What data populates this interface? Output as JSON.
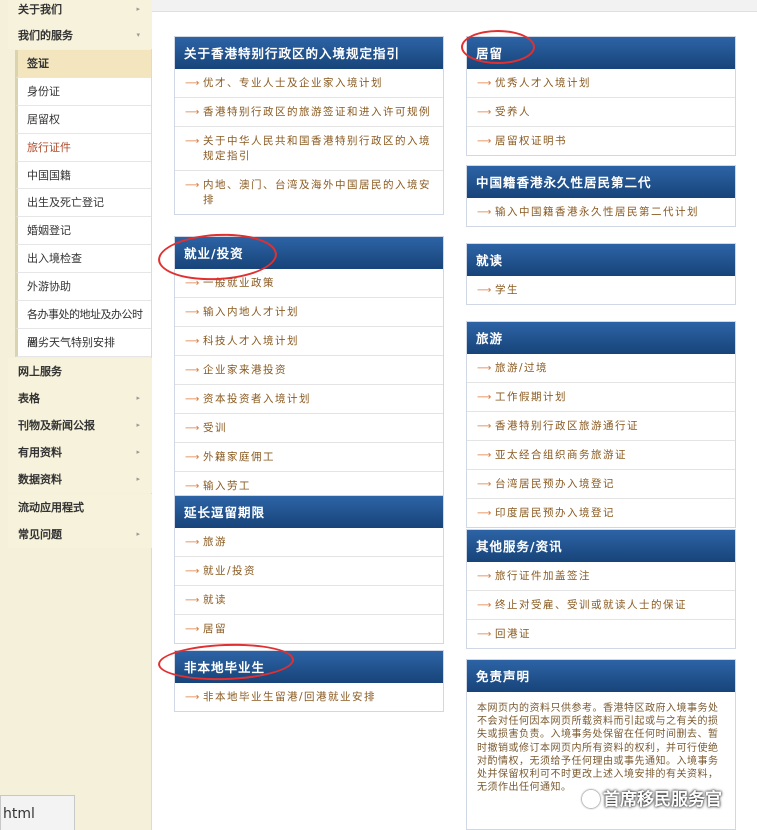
{
  "sidebar": {
    "nav_top": [
      {
        "label": "关于我们",
        "arrow": "▸"
      },
      {
        "label": "我们的服务",
        "arrow": "▾"
      }
    ],
    "sub": [
      "签证",
      "身份证",
      "居留权",
      "旅行证件",
      "中国国籍",
      "出生及死亡登记",
      "婚姻登记",
      "出入境检查",
      "外游协助",
      "各办事处的地址及办公时间",
      "恶劣天气特别安排"
    ],
    "nav_bottom": [
      {
        "label": "网上服务",
        "arrow": ""
      },
      {
        "label": "表格",
        "arrow": "▸"
      },
      {
        "label": "刊物及新闻公报",
        "arrow": "▸"
      },
      {
        "label": "有用资料",
        "arrow": "▸"
      },
      {
        "label": "数据资料",
        "arrow": "▸"
      },
      {
        "label": "流动应用程式",
        "arrow": ""
      },
      {
        "label": "常见问题",
        "arrow": "▸"
      }
    ]
  },
  "panels": {
    "entry": {
      "title": "关于香港特别行政区的入境规定指引",
      "items": [
        "优才、专业人士及企业家入境计划",
        "香港特别行政区的旅游签证和进入许可规例",
        "关于中华人民共和国香港特别行政区的入境规定指引",
        "内地、澳门、台湾及海外中国居民的入境安排"
      ]
    },
    "employment": {
      "title": "就业/投资",
      "items": [
        "一般就业政策",
        "输入内地人才计划",
        "科技人才入境计划",
        "企业家来港投资",
        "资本投资者入境计划",
        "受训",
        "外籍家庭佣工",
        "输入劳工"
      ]
    },
    "extension": {
      "title": "延长逗留期限",
      "items": [
        "旅游",
        "就业/投资",
        "就读",
        "居留"
      ]
    },
    "nonlocal": {
      "title": "非本地毕业生",
      "items": [
        "非本地毕业生留港/回港就业安排"
      ]
    },
    "residence": {
      "title": "居留",
      "items": [
        "优秀人才入境计划",
        "受养人",
        "居留权证明书"
      ]
    },
    "second_gen": {
      "title": "中国籍香港永久性居民第二代",
      "items": [
        "输入中国籍香港永久性居民第二代计划"
      ]
    },
    "study": {
      "title": "就读",
      "items": [
        "学生"
      ]
    },
    "travel": {
      "title": "旅游",
      "items": [
        "旅游/过境",
        "工作假期计划",
        "香港特别行政区旅游通行证",
        "亚太经合组织商务旅游证",
        "台湾居民预办入境登记",
        "印度居民预办入境登记"
      ]
    },
    "other": {
      "title": "其他服务/资讯",
      "items": [
        "旅行证件加盖签注",
        "终止对受雇、受训或就读人士的保证",
        "回港证"
      ]
    },
    "disclaimer": {
      "title": "免责声明",
      "text": "本网页内的资料只供参考。香港特区政府入境事务处不会对任何因本网页所载资料而引起或与之有关的损失或损害负责。入境事务处保留在任何时间删去、暂时撤销或修订本网页内所有资料的权利，并可行使绝对酌情权，无须给予任何理由或事先通知。入境事务处并保留权利可不时更改上述入境安排的有关资料，无须作出任何通知。"
    }
  },
  "watermark": "首席移民服务官",
  "taskbar_tab": "html",
  "colors": {
    "header": "#1e4f8a",
    "link": "#8a5a20",
    "chevron": "#e07a3a",
    "annotation": "#e23030"
  }
}
